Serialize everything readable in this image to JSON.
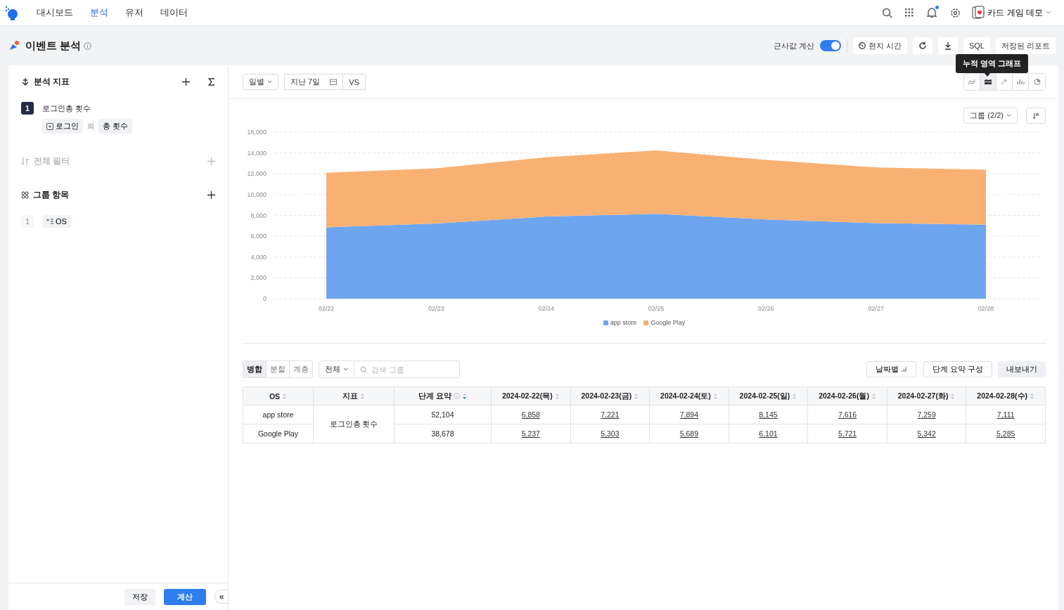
{
  "nav": {
    "tabs": [
      {
        "label": "대시보드",
        "selected": false
      },
      {
        "label": "분석",
        "selected": true
      },
      {
        "label": "유저",
        "selected": false
      },
      {
        "label": "데이터",
        "selected": false
      }
    ],
    "has_unread": true,
    "account": "카드 게임 데모"
  },
  "page": {
    "title": "이벤트 분석"
  },
  "toolbar": {
    "approx_label": "근사값 계산",
    "approx_on": true,
    "local_time": "현지 시간",
    "sql": "SQL",
    "saved_reports": "저장된 리포트"
  },
  "tooltip": "누적 영역 그래프",
  "sidebar": {
    "metrics_title": "분석 지표",
    "metrics": [
      {
        "index": "1",
        "name": "로그인총 횟수",
        "event": "로그인",
        "connector": "의",
        "measure": "총 횟수"
      }
    ],
    "filter_title": "전체 필터",
    "filter_disabled": true,
    "group_title": "그룹 항목",
    "groups": [
      {
        "index": "1",
        "name": "OS"
      }
    ],
    "save": "저장",
    "calculate": "계산",
    "collapse": "«"
  },
  "chart_controls": {
    "interval": "일별",
    "range": "지난 7일",
    "compare": "VS",
    "chart_types": [
      {
        "kind": "line",
        "selected": false
      },
      {
        "kind": "stacked_area",
        "selected": true
      },
      {
        "kind": "trend",
        "selected": false
      },
      {
        "kind": "bar",
        "selected": false
      },
      {
        "kind": "pie",
        "selected": false
      }
    ],
    "group_select": "그룹 (2/2)"
  },
  "chart_data": {
    "type": "area",
    "stacked": true,
    "grid": true,
    "legend": true,
    "categories": [
      "02/22",
      "02/23",
      "02/24",
      "02/25",
      "02/26",
      "02/27",
      "02/28"
    ],
    "series": [
      {
        "name": "app store",
        "color": "#6ea5ef",
        "values": [
          6858,
          7221,
          7894,
          8145,
          7616,
          7259,
          7111
        ]
      },
      {
        "name": "Google Play",
        "color": "#f8b173",
        "values": [
          5237,
          5303,
          5689,
          6101,
          5721,
          5342,
          5285
        ]
      }
    ],
    "ylim": [
      0,
      16000
    ],
    "yticks": [
      {
        "value": 0,
        "label": "0"
      },
      {
        "value": 2000,
        "label": "2,000"
      },
      {
        "value": 4000,
        "label": "4,000"
      },
      {
        "value": 6000,
        "label": "6,000"
      },
      {
        "value": 8000,
        "label": "8,000"
      },
      {
        "value": 10000,
        "label": "10,000"
      },
      {
        "value": 12000,
        "label": "12,000"
      },
      {
        "value": 14000,
        "label": "14,000"
      },
      {
        "value": 16000,
        "label": "16,000"
      }
    ]
  },
  "table_controls": {
    "view_modes": [
      {
        "label": "병합",
        "selected": true
      },
      {
        "label": "분할",
        "selected": false
      },
      {
        "label": "계층",
        "selected": false
      }
    ],
    "scope": "전체",
    "search_placeholder": "검색 그룹",
    "by_date": "날짜별",
    "configure": "단계 요약 구성",
    "export": "내보내기"
  },
  "table": {
    "columns": [
      {
        "label": "OS",
        "info": false,
        "sorted_desc": false
      },
      {
        "label": "지표",
        "info": false,
        "sorted_desc": false
      },
      {
        "label": "단계 요약",
        "info": true,
        "sorted_desc": true
      },
      {
        "label": "2024-02-22(목)",
        "info": false,
        "sorted_desc": false
      },
      {
        "label": "2024-02-23(금)",
        "info": false,
        "sorted_desc": false
      },
      {
        "label": "2024-02-24(토)",
        "info": false,
        "sorted_desc": false
      },
      {
        "label": "2024-02-25(일)",
        "info": false,
        "sorted_desc": false
      },
      {
        "label": "2024-02-26(월)",
        "info": false,
        "sorted_desc": false
      },
      {
        "label": "2024-02-27(화)",
        "info": false,
        "sorted_desc": false
      },
      {
        "label": "2024-02-28(수)",
        "info": false,
        "sorted_desc": false
      }
    ],
    "metric": "로그인총 횟수",
    "rows": [
      {
        "os": "app store",
        "summary": "52,104",
        "values": [
          "6,858",
          "7,221",
          "7,894",
          "8,145",
          "7,616",
          "7,259",
          "7,111"
        ]
      },
      {
        "os": "Google Play",
        "summary": "38,678",
        "values": [
          "5,237",
          "5,303",
          "5,689",
          "6,101",
          "5,721",
          "5,342",
          "5,285"
        ]
      }
    ]
  }
}
